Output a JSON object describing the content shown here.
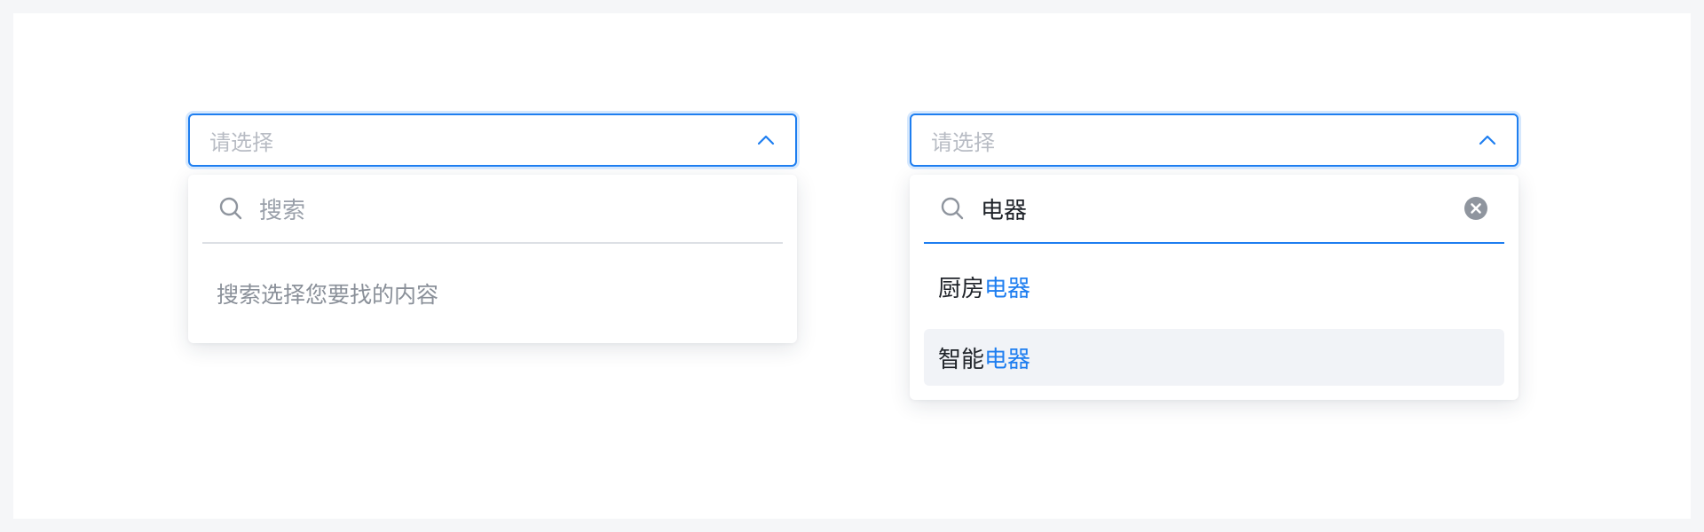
{
  "left_select": {
    "placeholder": "请选择",
    "search_placeholder": "搜索",
    "empty_text": "搜索选择您要找的内容"
  },
  "right_select": {
    "placeholder": "请选择",
    "search_value": "电器",
    "options": [
      {
        "prefix": "厨房",
        "match": "电器"
      },
      {
        "prefix": "智能",
        "match": "电器",
        "hovered": true
      }
    ]
  },
  "colors": {
    "accent": "#1e7ef0",
    "placeholder": "#b8bcc4",
    "text": "#1f2329",
    "muted": "#8a9099",
    "hover_bg": "#f1f3f7"
  }
}
